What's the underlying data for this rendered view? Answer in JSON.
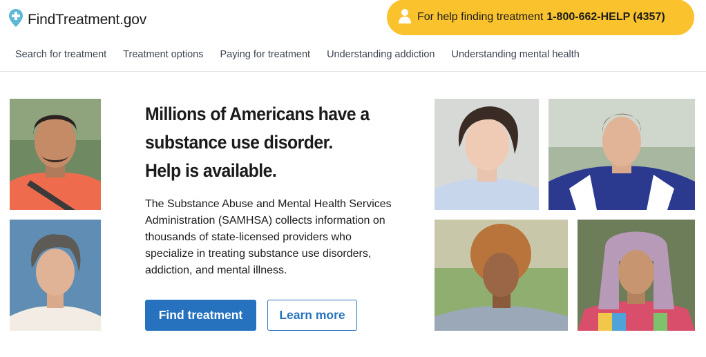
{
  "header": {
    "logo_text": "FindTreatment.gov",
    "helpline_text": "For help finding treatment",
    "helpline_number": "1-800-662-HELP (4357)"
  },
  "nav": {
    "items": [
      {
        "label": "Search for treatment"
      },
      {
        "label": "Treatment options"
      },
      {
        "label": "Paying for treatment"
      },
      {
        "label": "Understanding addiction"
      },
      {
        "label": "Understanding mental health"
      }
    ]
  },
  "hero": {
    "title_lines": [
      "Millions of Americans have a",
      "substance use disorder.",
      "Help is available."
    ],
    "body": "The Substance Abuse and Mental Health Services Administration (SAMHSA) collects information on thousands of state-licensed providers who specialize in treating substance use disorders, addiction, and mental illness.",
    "primary_button": "Find treatment",
    "secondary_button": "Learn more"
  },
  "colors": {
    "accent_blue": "#2672bf",
    "helpline_yellow": "#fac22d",
    "logo_blue": "#5cb8d6"
  }
}
